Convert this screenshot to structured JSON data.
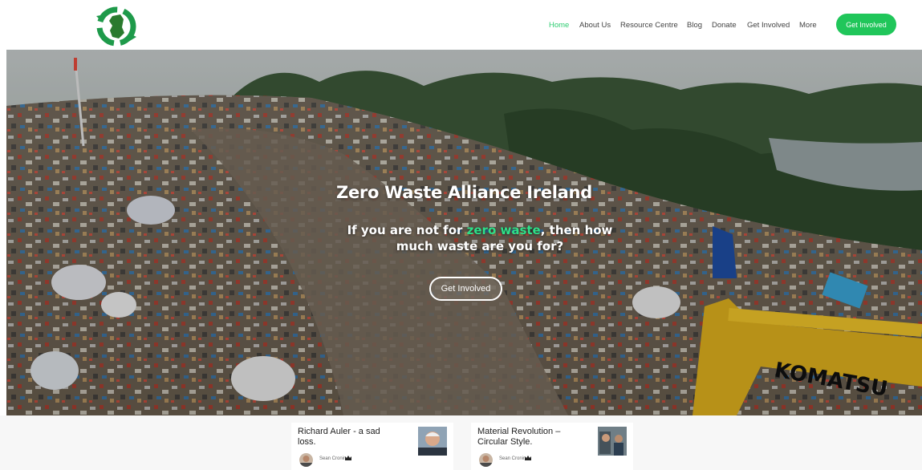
{
  "header": {
    "logo_icon": "recycle-ireland-logo-icon",
    "nav": [
      {
        "label": "Home",
        "active": true
      },
      {
        "label": "About Us",
        "active": false
      },
      {
        "label": "Resource Centre",
        "active": false
      },
      {
        "label": "Blog",
        "active": false
      },
      {
        "label": "Donate",
        "active": false
      },
      {
        "label": "Get Involved",
        "active": false
      },
      {
        "label": "More",
        "active": false
      }
    ],
    "cta_label": "Get Involved"
  },
  "hero": {
    "title": "Zero Waste Alliance Ireland",
    "subtitle_pre": "If you are not for ",
    "subtitle_highlight": "zero waste",
    "subtitle_post": ", then how much waste are you for?",
    "button_label": "Get Involved",
    "machine_brand": "KOMATSU"
  },
  "posts": [
    {
      "title": "Richard Auler - a sad loss.",
      "author": "Sean Cronin",
      "author_icon": "crown-icon"
    },
    {
      "title": "Material Revolution – Circular Style.",
      "author": "Sean Cronin",
      "author_icon": "crown-icon"
    }
  ],
  "colors": {
    "accent": "#20c65a",
    "highlight": "#2ee089",
    "nav_active": "#2ecc71"
  }
}
